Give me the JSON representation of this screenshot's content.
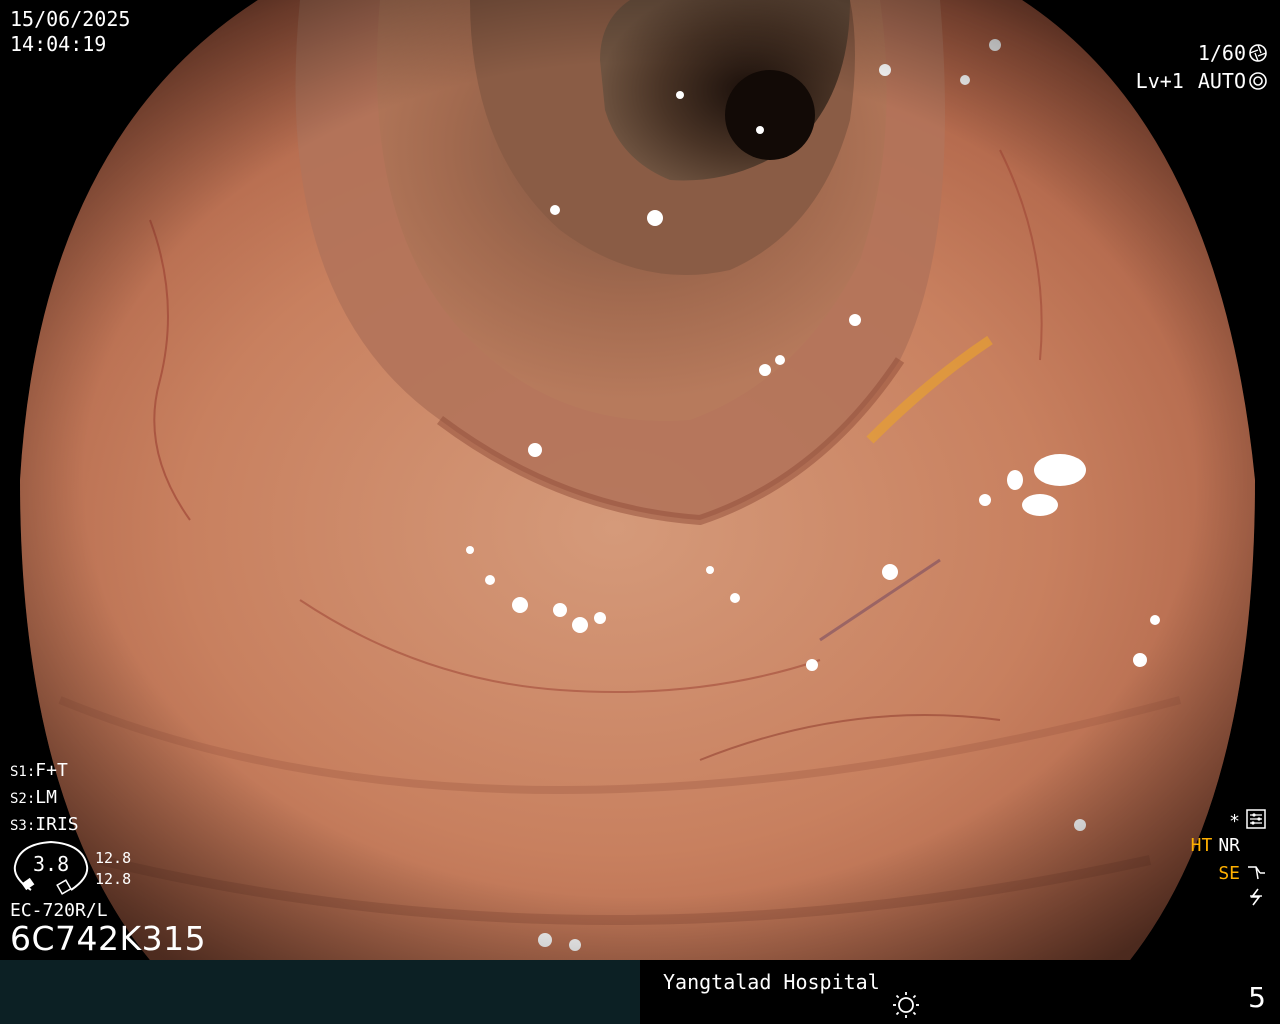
{
  "datetime": {
    "date": "15/06/2025",
    "time": "14:04:19"
  },
  "shutter": {
    "speed": "1/60",
    "level": "Lv+1",
    "mode": "AUTO"
  },
  "settings": [
    {
      "key": "S1",
      "value": "F+T"
    },
    {
      "key": "S2",
      "value": "LM"
    },
    {
      "key": "S3",
      "value": "IRIS"
    }
  ],
  "gauge": {
    "value": "3.8",
    "side_top": "12.8",
    "side_bottom": "12.8"
  },
  "scope": {
    "model": "EC-720R/L",
    "serial": "6C742K315"
  },
  "indicators": {
    "star": "*",
    "ht": "HT",
    "nr": "NR",
    "se": "SE"
  },
  "footer": {
    "hospital": "Yangtalad Hospital",
    "page": "5"
  },
  "colors": {
    "accent_orange": "#ffb000",
    "footer_left": "#0c2024",
    "tissue": "#c57a5c"
  },
  "icons": [
    "shutter-icon",
    "camera-icon",
    "settings-icon",
    "tone-icon",
    "no-flash-icon",
    "brightness-icon"
  ]
}
